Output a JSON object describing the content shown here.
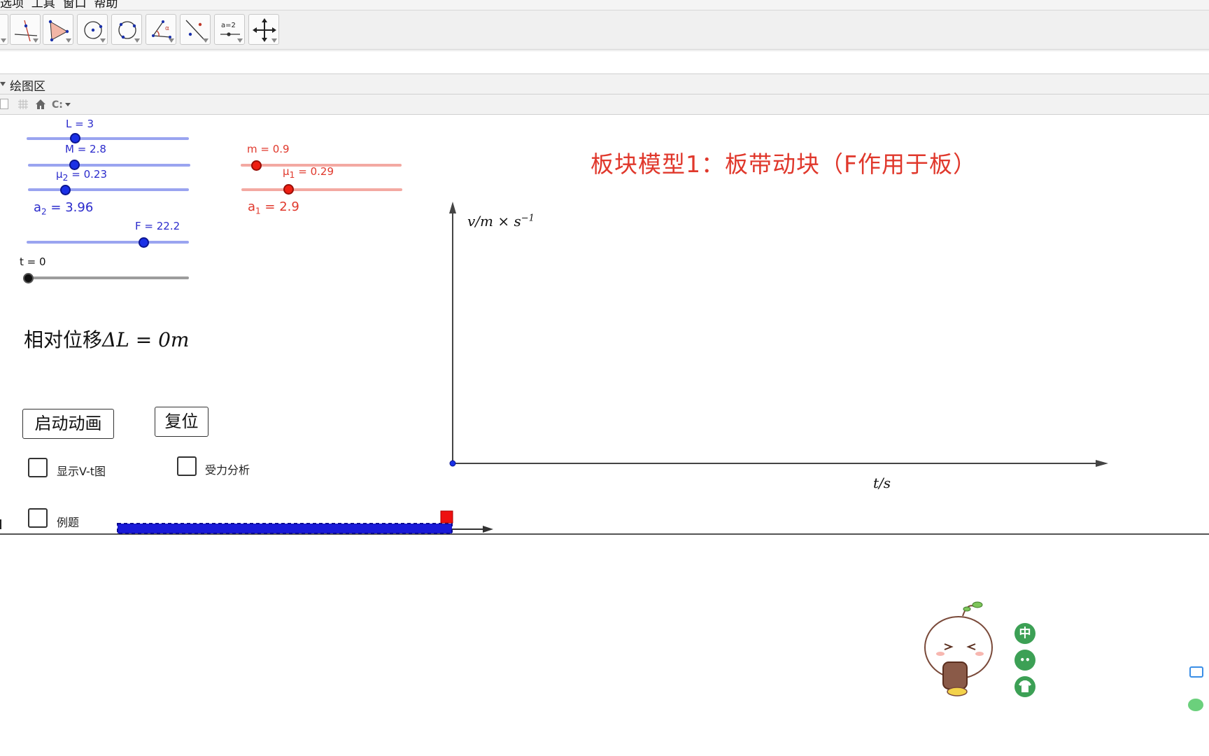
{
  "menu": {
    "text": "选项  工具  窗口  帮助"
  },
  "toolbar": {
    "tools": [
      {
        "name": "perpendicular-line-tool",
        "icon": "perpendicular-line-icon"
      },
      {
        "name": "polygon-tool",
        "icon": "polygon-icon"
      },
      {
        "name": "circle-center-point-tool",
        "icon": "circle-center-icon"
      },
      {
        "name": "circle-three-points-tool",
        "icon": "circle-three-points-icon"
      },
      {
        "name": "angle-tool",
        "icon": "angle-icon"
      },
      {
        "name": "reflect-tool",
        "icon": "reflect-icon"
      },
      {
        "name": "slider-tool",
        "icon": "slider-icon",
        "label": "a=2"
      },
      {
        "name": "move-view-tool",
        "icon": "move-arrows-icon"
      }
    ]
  },
  "view": {
    "title": "绘图区"
  },
  "sliders": {
    "L": {
      "label": "L = 3",
      "value": 3
    },
    "M": {
      "label": "M = 2.8",
      "value": 2.8
    },
    "mu2": {
      "label": "= 0.23",
      "value": 0.23,
      "sym": "μ",
      "sub": "2"
    },
    "F": {
      "label": "F = 22.2",
      "value": 22.2
    },
    "t": {
      "label": "t = 0",
      "value": 0
    },
    "m": {
      "label": "m = 0.9",
      "value": 0.9
    },
    "mu1": {
      "label": "= 0.29",
      "value": 0.29,
      "sym": "μ",
      "sub": "1"
    }
  },
  "values": {
    "a2": {
      "sym": "a",
      "sub": "2",
      "eq": "=",
      "value": "3.96"
    },
    "a1": {
      "sym": "a",
      "sub": "1",
      "eq": "=",
      "value": "2.9"
    }
  },
  "title": "板块模型1：板带动块（F作用于板）",
  "relative": {
    "prefix": "相对位移",
    "math": "ΔL = 0m"
  },
  "buttons": {
    "start": "启动动画",
    "reset": "复位"
  },
  "checkboxes": {
    "vt": "显示V-t图",
    "force": "受力分析",
    "example": "例题"
  },
  "graph": {
    "ylabel": "v/m × s",
    "ylabel_exp": "−1",
    "xlabel": "t/s"
  },
  "side": {
    "icons": [
      "中",
      "••",
      "👕"
    ]
  },
  "colors": {
    "blue": "#1a30e6",
    "red": "#e0382c",
    "track_blue": "#9aa4f0",
    "track_red": "#f3a9a2"
  }
}
